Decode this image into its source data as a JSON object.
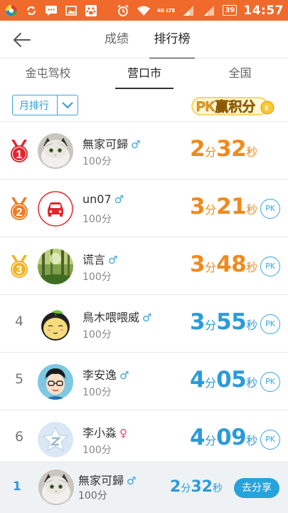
{
  "status_bar": {
    "time": "14:57",
    "battery": "39",
    "network": "4G LTE",
    "icons": [
      "launcher-icon",
      "sync-icon",
      "message-icon",
      "gallery-icon",
      "paw-icon",
      "alarm-icon",
      "wifi-icon",
      "signal-icon",
      "signal-icon",
      "battery-icon"
    ]
  },
  "header": {
    "back_icon": "arrow-left-icon",
    "tabs": [
      {
        "label": "成绩",
        "active": false
      },
      {
        "label": "排行榜",
        "active": true
      }
    ]
  },
  "region_tabs": [
    {
      "label": "金屯驾校",
      "active": false
    },
    {
      "label": "营口市",
      "active": true
    },
    {
      "label": "全国",
      "active": false
    }
  ],
  "filter": {
    "label": "月排行",
    "icon": "chevron-down-icon"
  },
  "pk_banner": {
    "text": "PK赢积分"
  },
  "ranking": [
    {
      "rank": "1",
      "medal": "red",
      "name": "無家可歸",
      "gender": "♂",
      "score": "100分",
      "min": "2",
      "min_unit": "分",
      "sec": "32",
      "sec_unit": "秒",
      "color": "orange",
      "pk": "",
      "avatar": "cat"
    },
    {
      "rank": "2",
      "medal": "orange",
      "name": "un07",
      "gender": "♂",
      "score": "100分",
      "min": "3",
      "min_unit": "分",
      "sec": "21",
      "sec_unit": "秒",
      "color": "orange",
      "pk": "PK",
      "avatar": "car"
    },
    {
      "rank": "3",
      "medal": "gold",
      "name": "谎言",
      "gender": "♂",
      "score": "100分",
      "min": "3",
      "min_unit": "分",
      "sec": "48",
      "sec_unit": "秒",
      "color": "orange",
      "pk": "PK",
      "avatar": "forest"
    },
    {
      "rank": "4",
      "medal": "",
      "name": "鳥木喂喂威",
      "gender": "♂",
      "score": "100分",
      "min": "3",
      "min_unit": "分",
      "sec": "55",
      "sec_unit": "秒",
      "color": "blue",
      "pk": "PK",
      "avatar": "cartoon"
    },
    {
      "rank": "5",
      "medal": "",
      "name": "李安逸",
      "gender": "♂",
      "score": "100分",
      "min": "4",
      "min_unit": "分",
      "sec": "05",
      "sec_unit": "秒",
      "color": "blue",
      "pk": "PK",
      "avatar": "boy"
    },
    {
      "rank": "6",
      "medal": "",
      "name": "李小淼",
      "gender": "♀",
      "score": "100分",
      "min": "4",
      "min_unit": "分",
      "sec": "09",
      "sec_unit": "秒",
      "color": "blue",
      "pk": "PK",
      "avatar": "star"
    }
  ],
  "my_rank": {
    "rank": "1",
    "name": "無家可歸",
    "gender": "♂",
    "score": "100分",
    "min": "2",
    "min_unit": "分",
    "sec": "32",
    "sec_unit": "秒",
    "share_label": "去分享"
  },
  "colors": {
    "status_bar": "#f06a2b",
    "accent_blue": "#2b9bd8",
    "time_orange": "#f08a1c",
    "medal_red": "#e0262d",
    "medal_orange": "#f07a22",
    "medal_gold": "#f2b21c"
  }
}
